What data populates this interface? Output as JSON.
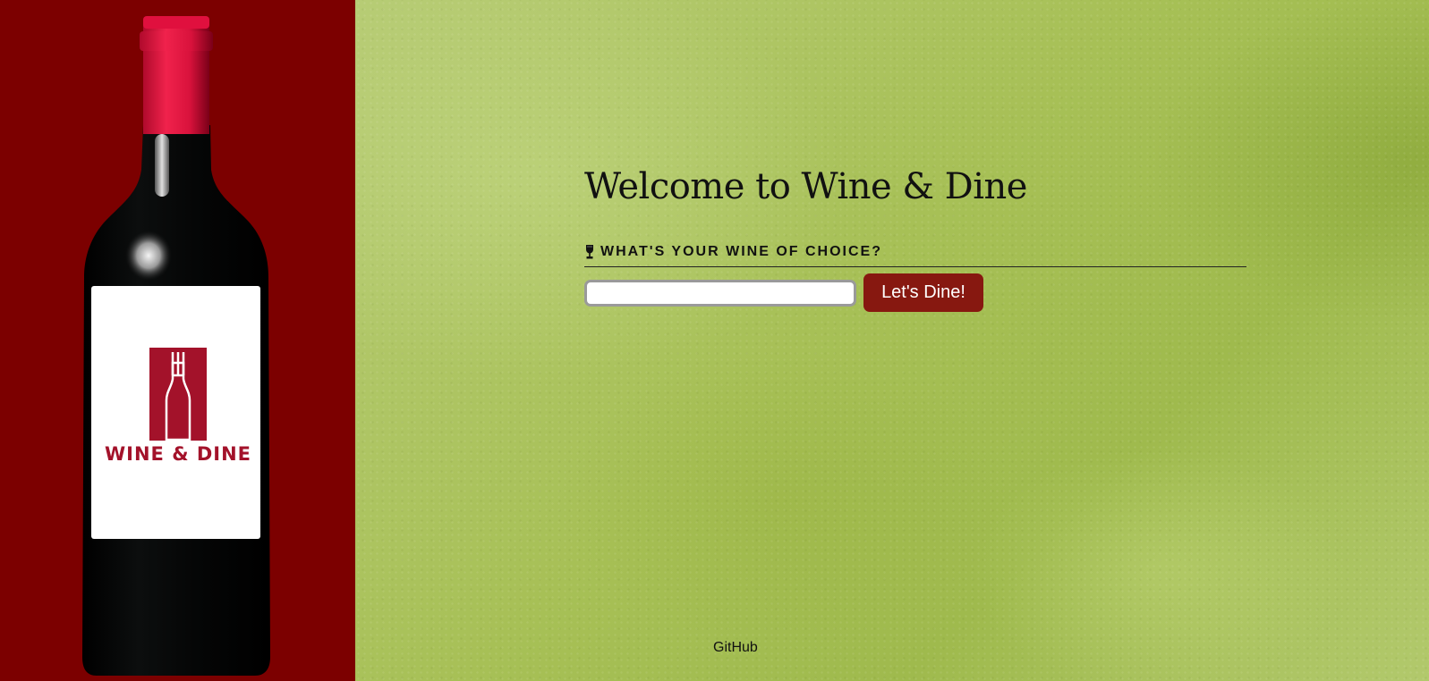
{
  "sidebar": {
    "logo": {
      "text": "WINE & DINE",
      "icon": "wine-bottle-fork-logo"
    },
    "colors": {
      "background": "#7c0000",
      "bottle": "#060808",
      "capsule": "#e0103e",
      "label_brand": "#a3122a"
    }
  },
  "main": {
    "title": "Welcome to Wine & Dine",
    "question": {
      "icon": "wine-glass-icon",
      "label": "WHAT'S YOUR WINE OF CHOICE?"
    },
    "input": {
      "value": "",
      "placeholder": ""
    },
    "submit_button": {
      "label": "Let's Dine!"
    },
    "footer": {
      "github_label": "GitHub"
    },
    "colors": {
      "button": "#871810",
      "background": "#a7c056"
    }
  }
}
